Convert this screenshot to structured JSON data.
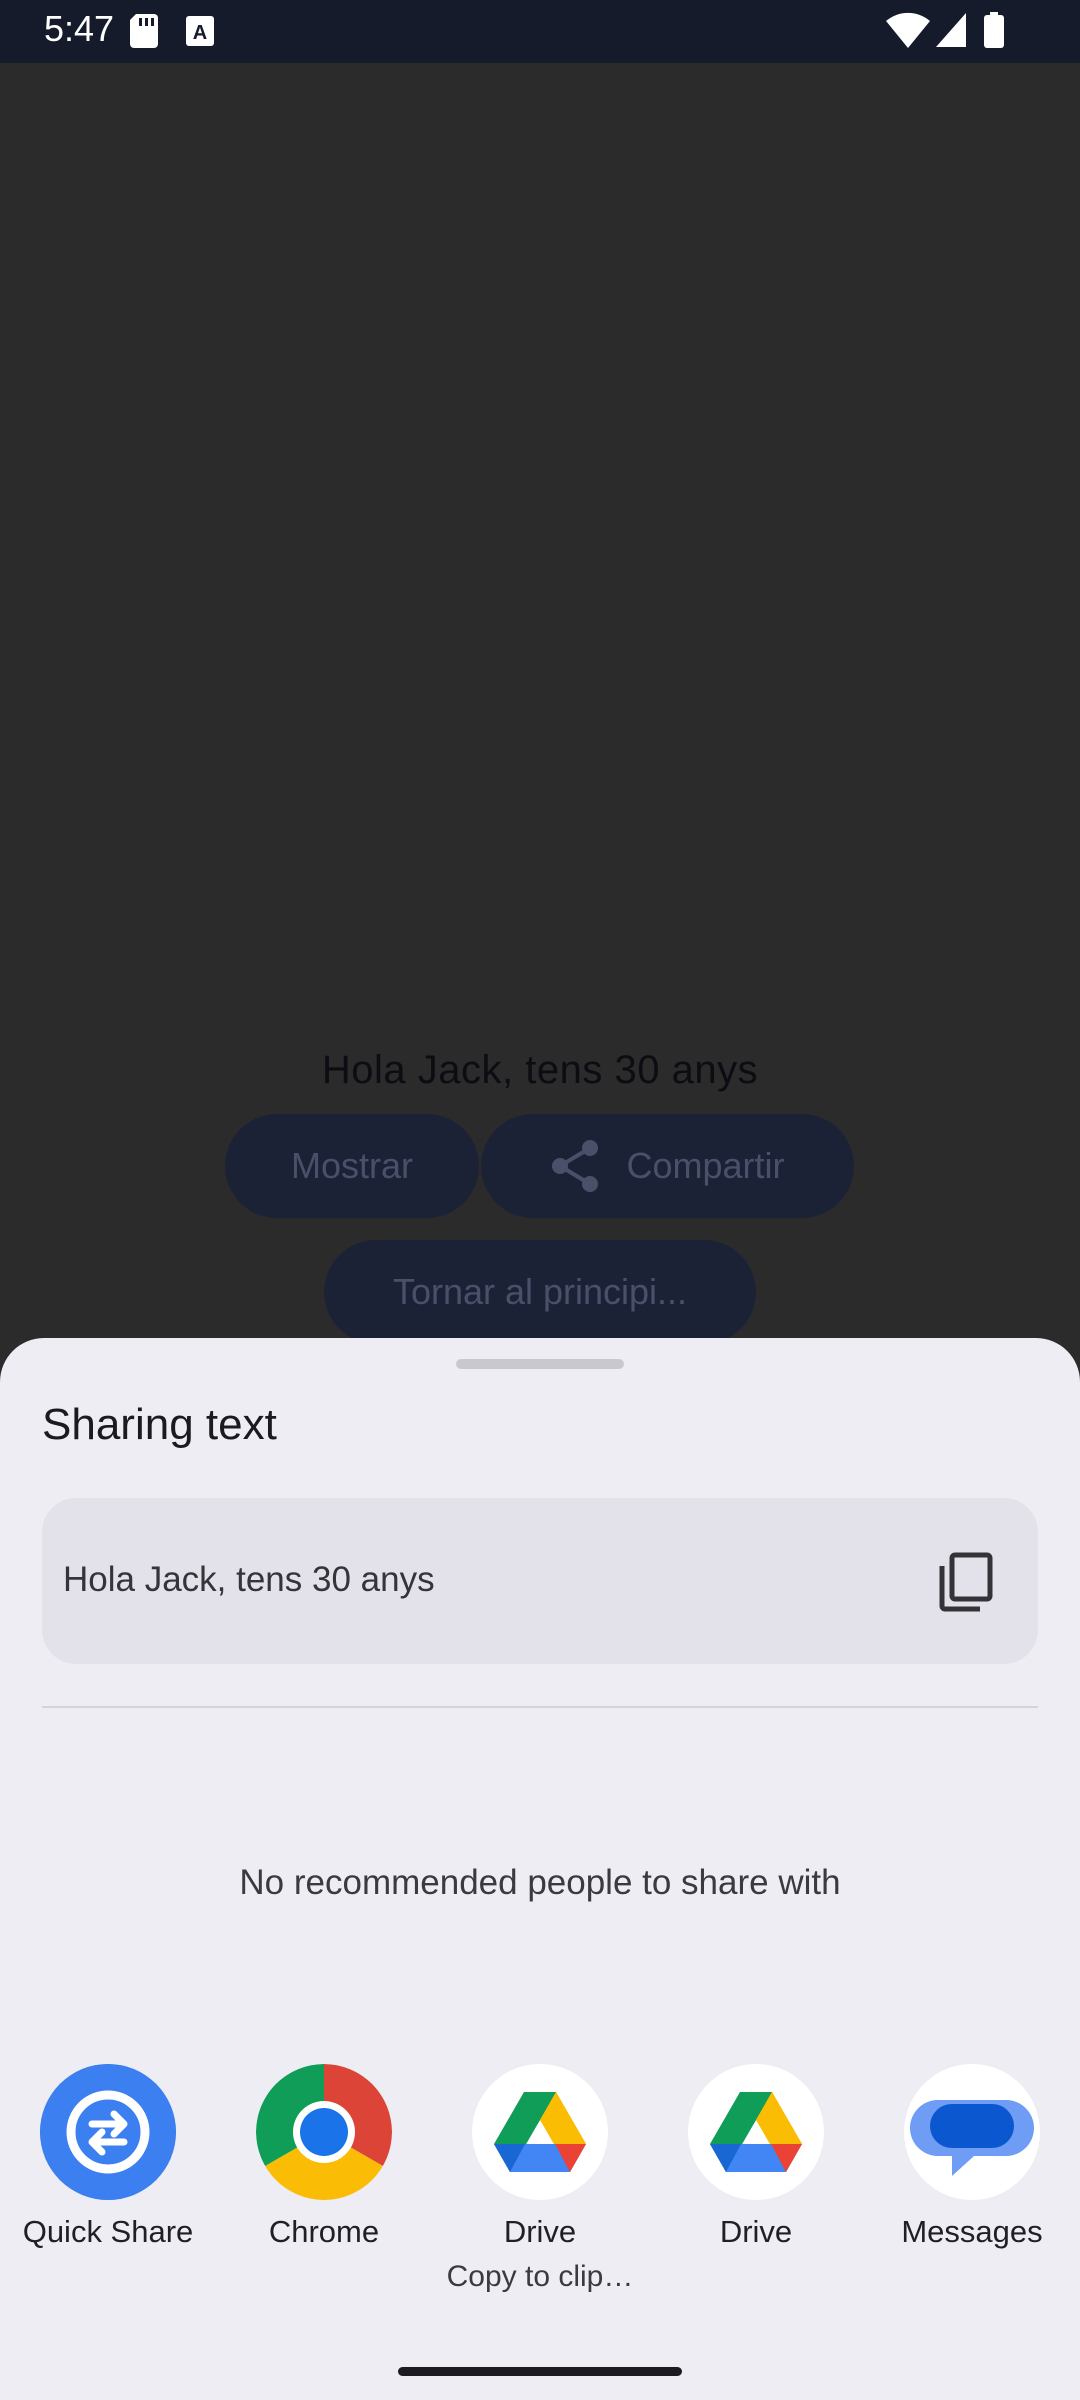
{
  "status_bar": {
    "time": "5:47",
    "icons": [
      "sd-card-icon",
      "keyboard-a-icon",
      "wifi-icon",
      "signal-icon",
      "battery-icon"
    ]
  },
  "app": {
    "greeting": "Hola Jack, tens 30 anys",
    "show_button": "Mostrar",
    "share_button": "Compartir",
    "home_button": "Tornar al principi..."
  },
  "sheet": {
    "title": "Sharing text",
    "preview_text": "Hola Jack, tens 30 anys",
    "no_people": "No recommended people to share with",
    "targets": [
      {
        "label": "Quick Share",
        "icon": "quick-share-icon",
        "color": "#3b7ff0"
      },
      {
        "label": "Chrome",
        "icon": "chrome-icon",
        "color": "#1a73e8"
      },
      {
        "label": "Drive",
        "sublabel": "Copy to clip…",
        "icon": "drive-icon",
        "color": "#ffffff"
      },
      {
        "label": "Drive",
        "icon": "drive-icon",
        "color": "#ffffff"
      },
      {
        "label": "Messages",
        "icon": "messages-icon",
        "color": "#0b57d0"
      }
    ]
  }
}
